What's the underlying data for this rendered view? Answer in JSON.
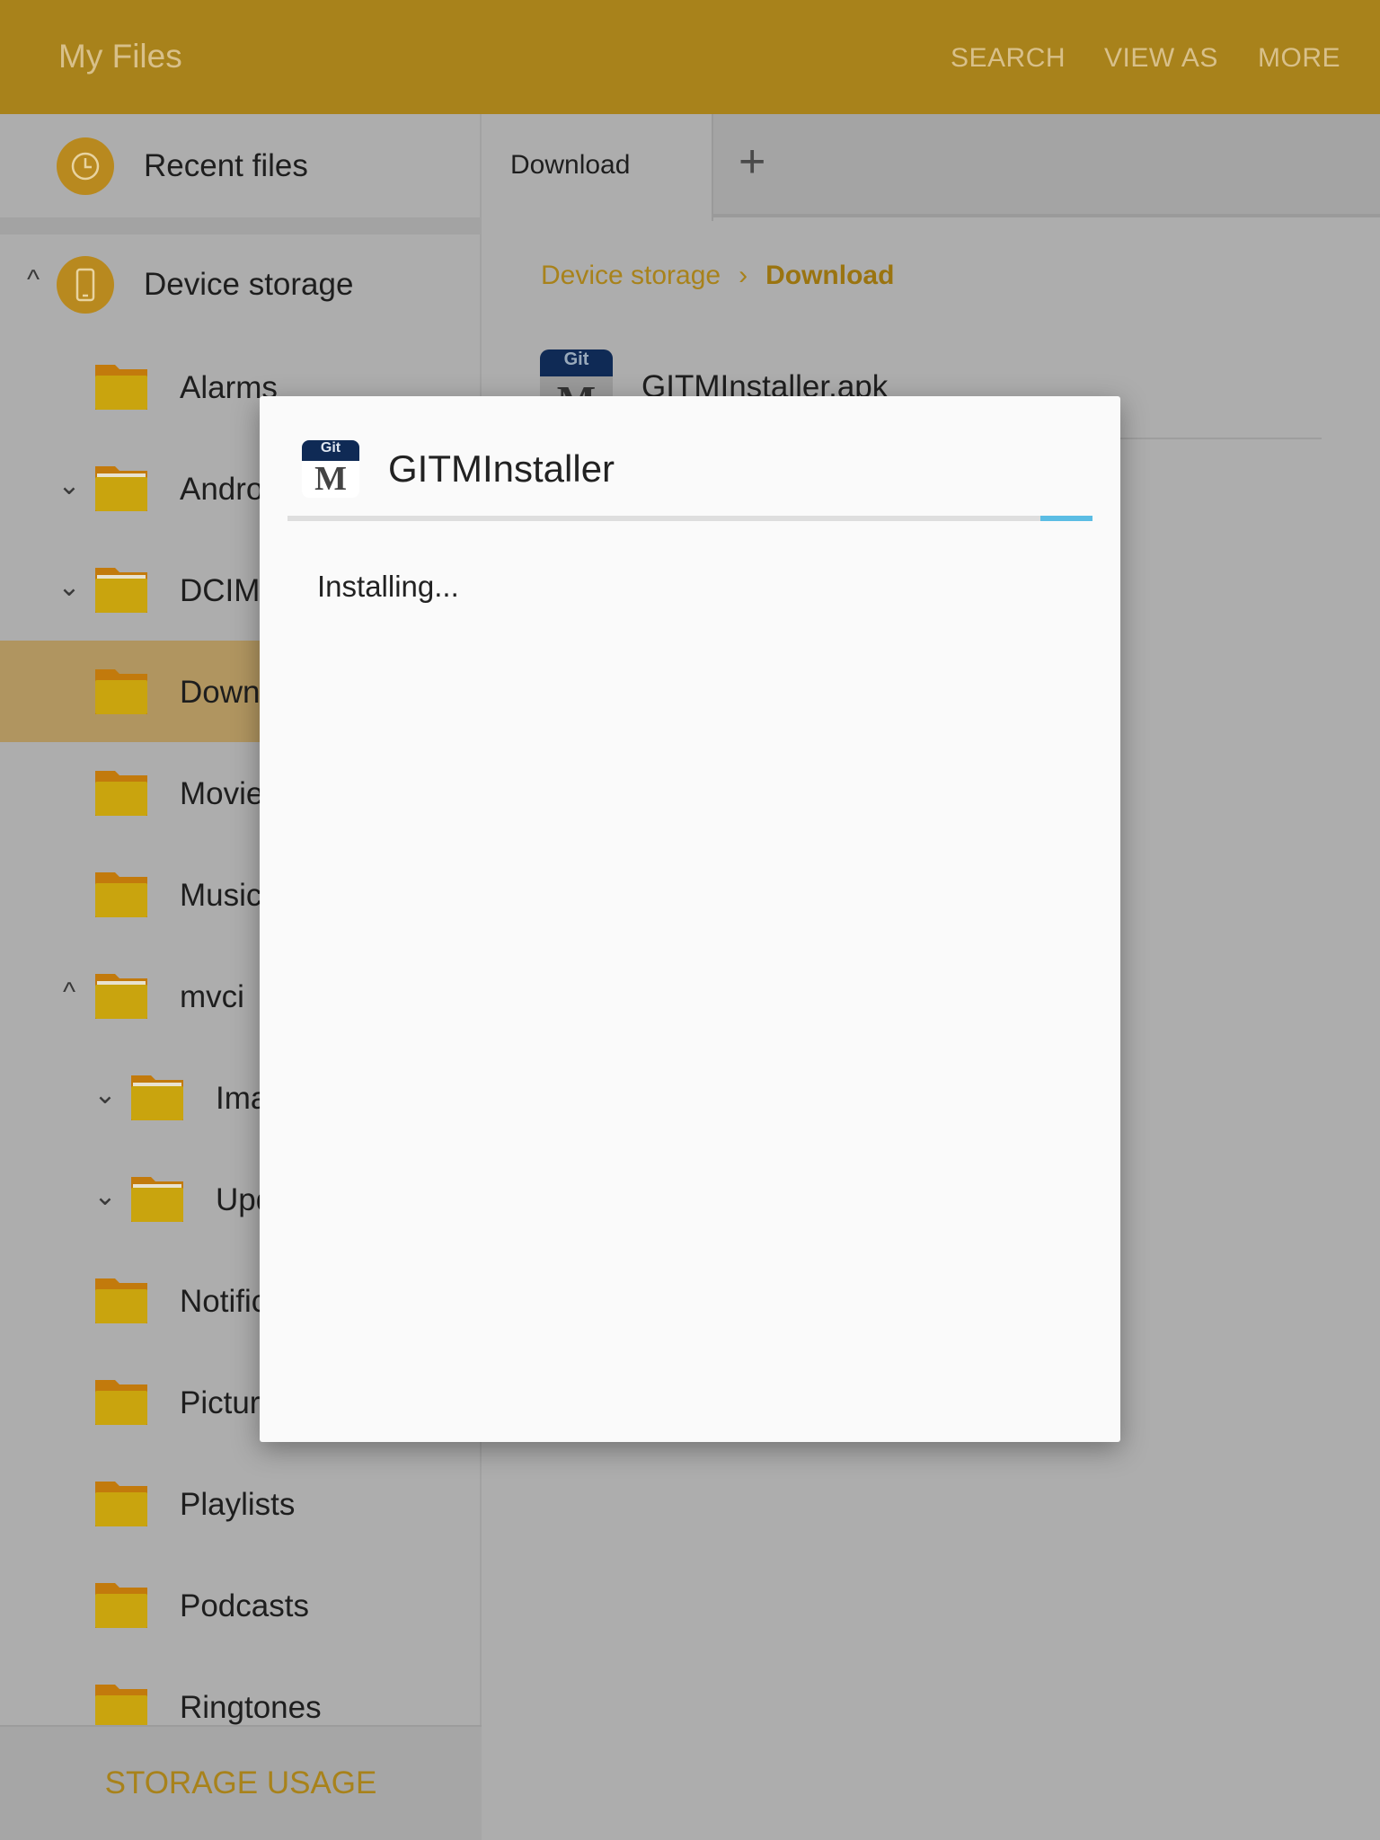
{
  "header": {
    "title": "My Files",
    "actions": [
      "SEARCH",
      "VIEW AS",
      "MORE"
    ],
    "color": "#a8821b"
  },
  "sidebar": {
    "recent": "Recent files",
    "device_storage": "Device storage",
    "folders": [
      {
        "name": "Alarms",
        "level": 1,
        "chevron": ""
      },
      {
        "name": "Android",
        "level": 1,
        "chevron": "down"
      },
      {
        "name": "DCIM",
        "level": 1,
        "chevron": "down"
      },
      {
        "name": "Download",
        "level": 1,
        "chevron": "",
        "selected": true
      },
      {
        "name": "Movies",
        "level": 1,
        "chevron": ""
      },
      {
        "name": "Music",
        "level": 1,
        "chevron": ""
      },
      {
        "name": "mvci",
        "level": 1,
        "chevron": "up"
      },
      {
        "name": "Images",
        "level": 2,
        "chevron": "down"
      },
      {
        "name": "Updates",
        "level": 2,
        "chevron": "down"
      },
      {
        "name": "Notifications",
        "level": 1,
        "chevron": ""
      },
      {
        "name": "Pictures",
        "level": 1,
        "chevron": ""
      },
      {
        "name": "Playlists",
        "level": 1,
        "chevron": ""
      },
      {
        "name": "Podcasts",
        "level": 1,
        "chevron": ""
      },
      {
        "name": "Ringtones",
        "level": 1,
        "chevron": ""
      }
    ],
    "storage_usage": "STORAGE USAGE"
  },
  "tabs": {
    "active": "Download",
    "add": "+"
  },
  "breadcrumb": {
    "parent": "Device storage",
    "separator": "›",
    "current": "Download"
  },
  "files": [
    {
      "name": "GITMInstaller.apk",
      "icon": "gitm-app-icon"
    }
  ],
  "dialog": {
    "title": "GITMInstaller",
    "icon_top": "Git",
    "icon_letter": "M",
    "message": "Installing...",
    "progress_color": "#5bbde4",
    "progress": "indeterminate"
  }
}
